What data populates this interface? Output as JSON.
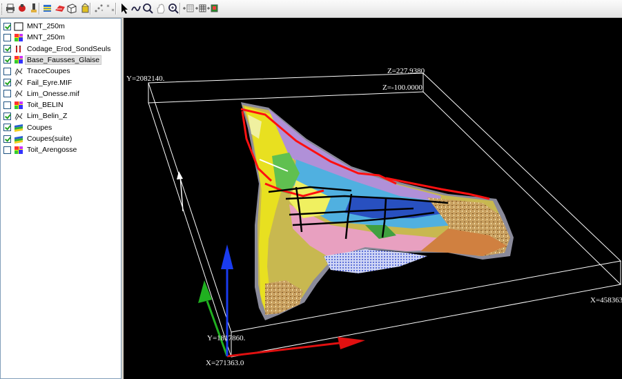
{
  "toolbar": {
    "buttons": [
      "print-icon",
      "open-icon",
      "pin-icon",
      "layers-icon",
      "surface-icon",
      "cube-icon",
      "object-icon",
      "scatter-icon",
      "cross-points-icon",
      "pointer-icon",
      "lasso-icon",
      "zoom-icon",
      "pan-hand-icon",
      "zoom-window-icon",
      "add-grid-icon",
      "add-section-icon",
      "add-image-icon"
    ]
  },
  "layers": [
    {
      "name": "MNT_250m",
      "checked": true,
      "icon": "empty-frame-icon"
    },
    {
      "name": "MNT_250m",
      "checked": false,
      "icon": "colorful-grid-icon"
    },
    {
      "name": "Codage_Erod_SondSeuls",
      "checked": true,
      "icon": "drillhole-icon"
    },
    {
      "name": "Base_Fausses_Glaise",
      "checked": true,
      "icon": "colorful-grid-icon",
      "selected": true
    },
    {
      "name": "TraceCoupes",
      "checked": false,
      "icon": "polyline-icon"
    },
    {
      "name": "Fail_Eyre.MIF",
      "checked": true,
      "icon": "polyline-icon"
    },
    {
      "name": "Lim_Onesse.mif",
      "checked": false,
      "icon": "polyline-icon"
    },
    {
      "name": "Toit_BELIN",
      "checked": false,
      "icon": "colorful-grid-icon"
    },
    {
      "name": "Lim_Belin_Z",
      "checked": true,
      "icon": "polyline-icon"
    },
    {
      "name": "Coupes",
      "checked": true,
      "icon": "sections-icon"
    },
    {
      "name": "Coupes(suite)",
      "checked": true,
      "icon": "sections-icon"
    },
    {
      "name": "Toit_Arengosse",
      "checked": false,
      "icon": "colorful-grid-icon"
    }
  ],
  "view3d": {
    "label_y_top": "Y=2082140.",
    "label_z_top": "Z=227.9380",
    "label_z_bottom": "Z=-100.0000",
    "label_x_right": "X=458363",
    "label_y_bottom": "Y=1817860.",
    "label_x_origin": "X=271363.0",
    "axis_colors": {
      "x": "#e01010",
      "y": "#20b020",
      "z": "#1a3cf0"
    },
    "background": "#000000"
  }
}
